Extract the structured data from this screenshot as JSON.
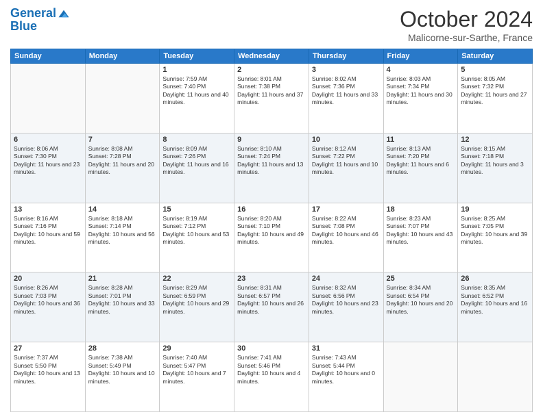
{
  "header": {
    "logo_line1": "General",
    "logo_line2": "Blue",
    "month": "October 2024",
    "location": "Malicorne-sur-Sarthe, France"
  },
  "days_of_week": [
    "Sunday",
    "Monday",
    "Tuesday",
    "Wednesday",
    "Thursday",
    "Friday",
    "Saturday"
  ],
  "weeks": [
    [
      {
        "day": "",
        "sunrise": "",
        "sunset": "",
        "daylight": ""
      },
      {
        "day": "",
        "sunrise": "",
        "sunset": "",
        "daylight": ""
      },
      {
        "day": "1",
        "sunrise": "Sunrise: 7:59 AM",
        "sunset": "Sunset: 7:40 PM",
        "daylight": "Daylight: 11 hours and 40 minutes."
      },
      {
        "day": "2",
        "sunrise": "Sunrise: 8:01 AM",
        "sunset": "Sunset: 7:38 PM",
        "daylight": "Daylight: 11 hours and 37 minutes."
      },
      {
        "day": "3",
        "sunrise": "Sunrise: 8:02 AM",
        "sunset": "Sunset: 7:36 PM",
        "daylight": "Daylight: 11 hours and 33 minutes."
      },
      {
        "day": "4",
        "sunrise": "Sunrise: 8:03 AM",
        "sunset": "Sunset: 7:34 PM",
        "daylight": "Daylight: 11 hours and 30 minutes."
      },
      {
        "day": "5",
        "sunrise": "Sunrise: 8:05 AM",
        "sunset": "Sunset: 7:32 PM",
        "daylight": "Daylight: 11 hours and 27 minutes."
      }
    ],
    [
      {
        "day": "6",
        "sunrise": "Sunrise: 8:06 AM",
        "sunset": "Sunset: 7:30 PM",
        "daylight": "Daylight: 11 hours and 23 minutes."
      },
      {
        "day": "7",
        "sunrise": "Sunrise: 8:08 AM",
        "sunset": "Sunset: 7:28 PM",
        "daylight": "Daylight: 11 hours and 20 minutes."
      },
      {
        "day": "8",
        "sunrise": "Sunrise: 8:09 AM",
        "sunset": "Sunset: 7:26 PM",
        "daylight": "Daylight: 11 hours and 16 minutes."
      },
      {
        "day": "9",
        "sunrise": "Sunrise: 8:10 AM",
        "sunset": "Sunset: 7:24 PM",
        "daylight": "Daylight: 11 hours and 13 minutes."
      },
      {
        "day": "10",
        "sunrise": "Sunrise: 8:12 AM",
        "sunset": "Sunset: 7:22 PM",
        "daylight": "Daylight: 11 hours and 10 minutes."
      },
      {
        "day": "11",
        "sunrise": "Sunrise: 8:13 AM",
        "sunset": "Sunset: 7:20 PM",
        "daylight": "Daylight: 11 hours and 6 minutes."
      },
      {
        "day": "12",
        "sunrise": "Sunrise: 8:15 AM",
        "sunset": "Sunset: 7:18 PM",
        "daylight": "Daylight: 11 hours and 3 minutes."
      }
    ],
    [
      {
        "day": "13",
        "sunrise": "Sunrise: 8:16 AM",
        "sunset": "Sunset: 7:16 PM",
        "daylight": "Daylight: 10 hours and 59 minutes."
      },
      {
        "day": "14",
        "sunrise": "Sunrise: 8:18 AM",
        "sunset": "Sunset: 7:14 PM",
        "daylight": "Daylight: 10 hours and 56 minutes."
      },
      {
        "day": "15",
        "sunrise": "Sunrise: 8:19 AM",
        "sunset": "Sunset: 7:12 PM",
        "daylight": "Daylight: 10 hours and 53 minutes."
      },
      {
        "day": "16",
        "sunrise": "Sunrise: 8:20 AM",
        "sunset": "Sunset: 7:10 PM",
        "daylight": "Daylight: 10 hours and 49 minutes."
      },
      {
        "day": "17",
        "sunrise": "Sunrise: 8:22 AM",
        "sunset": "Sunset: 7:08 PM",
        "daylight": "Daylight: 10 hours and 46 minutes."
      },
      {
        "day": "18",
        "sunrise": "Sunrise: 8:23 AM",
        "sunset": "Sunset: 7:07 PM",
        "daylight": "Daylight: 10 hours and 43 minutes."
      },
      {
        "day": "19",
        "sunrise": "Sunrise: 8:25 AM",
        "sunset": "Sunset: 7:05 PM",
        "daylight": "Daylight: 10 hours and 39 minutes."
      }
    ],
    [
      {
        "day": "20",
        "sunrise": "Sunrise: 8:26 AM",
        "sunset": "Sunset: 7:03 PM",
        "daylight": "Daylight: 10 hours and 36 minutes."
      },
      {
        "day": "21",
        "sunrise": "Sunrise: 8:28 AM",
        "sunset": "Sunset: 7:01 PM",
        "daylight": "Daylight: 10 hours and 33 minutes."
      },
      {
        "day": "22",
        "sunrise": "Sunrise: 8:29 AM",
        "sunset": "Sunset: 6:59 PM",
        "daylight": "Daylight: 10 hours and 29 minutes."
      },
      {
        "day": "23",
        "sunrise": "Sunrise: 8:31 AM",
        "sunset": "Sunset: 6:57 PM",
        "daylight": "Daylight: 10 hours and 26 minutes."
      },
      {
        "day": "24",
        "sunrise": "Sunrise: 8:32 AM",
        "sunset": "Sunset: 6:56 PM",
        "daylight": "Daylight: 10 hours and 23 minutes."
      },
      {
        "day": "25",
        "sunrise": "Sunrise: 8:34 AM",
        "sunset": "Sunset: 6:54 PM",
        "daylight": "Daylight: 10 hours and 20 minutes."
      },
      {
        "day": "26",
        "sunrise": "Sunrise: 8:35 AM",
        "sunset": "Sunset: 6:52 PM",
        "daylight": "Daylight: 10 hours and 16 minutes."
      }
    ],
    [
      {
        "day": "27",
        "sunrise": "Sunrise: 7:37 AM",
        "sunset": "Sunset: 5:50 PM",
        "daylight": "Daylight: 10 hours and 13 minutes."
      },
      {
        "day": "28",
        "sunrise": "Sunrise: 7:38 AM",
        "sunset": "Sunset: 5:49 PM",
        "daylight": "Daylight: 10 hours and 10 minutes."
      },
      {
        "day": "29",
        "sunrise": "Sunrise: 7:40 AM",
        "sunset": "Sunset: 5:47 PM",
        "daylight": "Daylight: 10 hours and 7 minutes."
      },
      {
        "day": "30",
        "sunrise": "Sunrise: 7:41 AM",
        "sunset": "Sunset: 5:46 PM",
        "daylight": "Daylight: 10 hours and 4 minutes."
      },
      {
        "day": "31",
        "sunrise": "Sunrise: 7:43 AM",
        "sunset": "Sunset: 5:44 PM",
        "daylight": "Daylight: 10 hours and 0 minutes."
      },
      {
        "day": "",
        "sunrise": "",
        "sunset": "",
        "daylight": ""
      },
      {
        "day": "",
        "sunrise": "",
        "sunset": "",
        "daylight": ""
      }
    ]
  ]
}
